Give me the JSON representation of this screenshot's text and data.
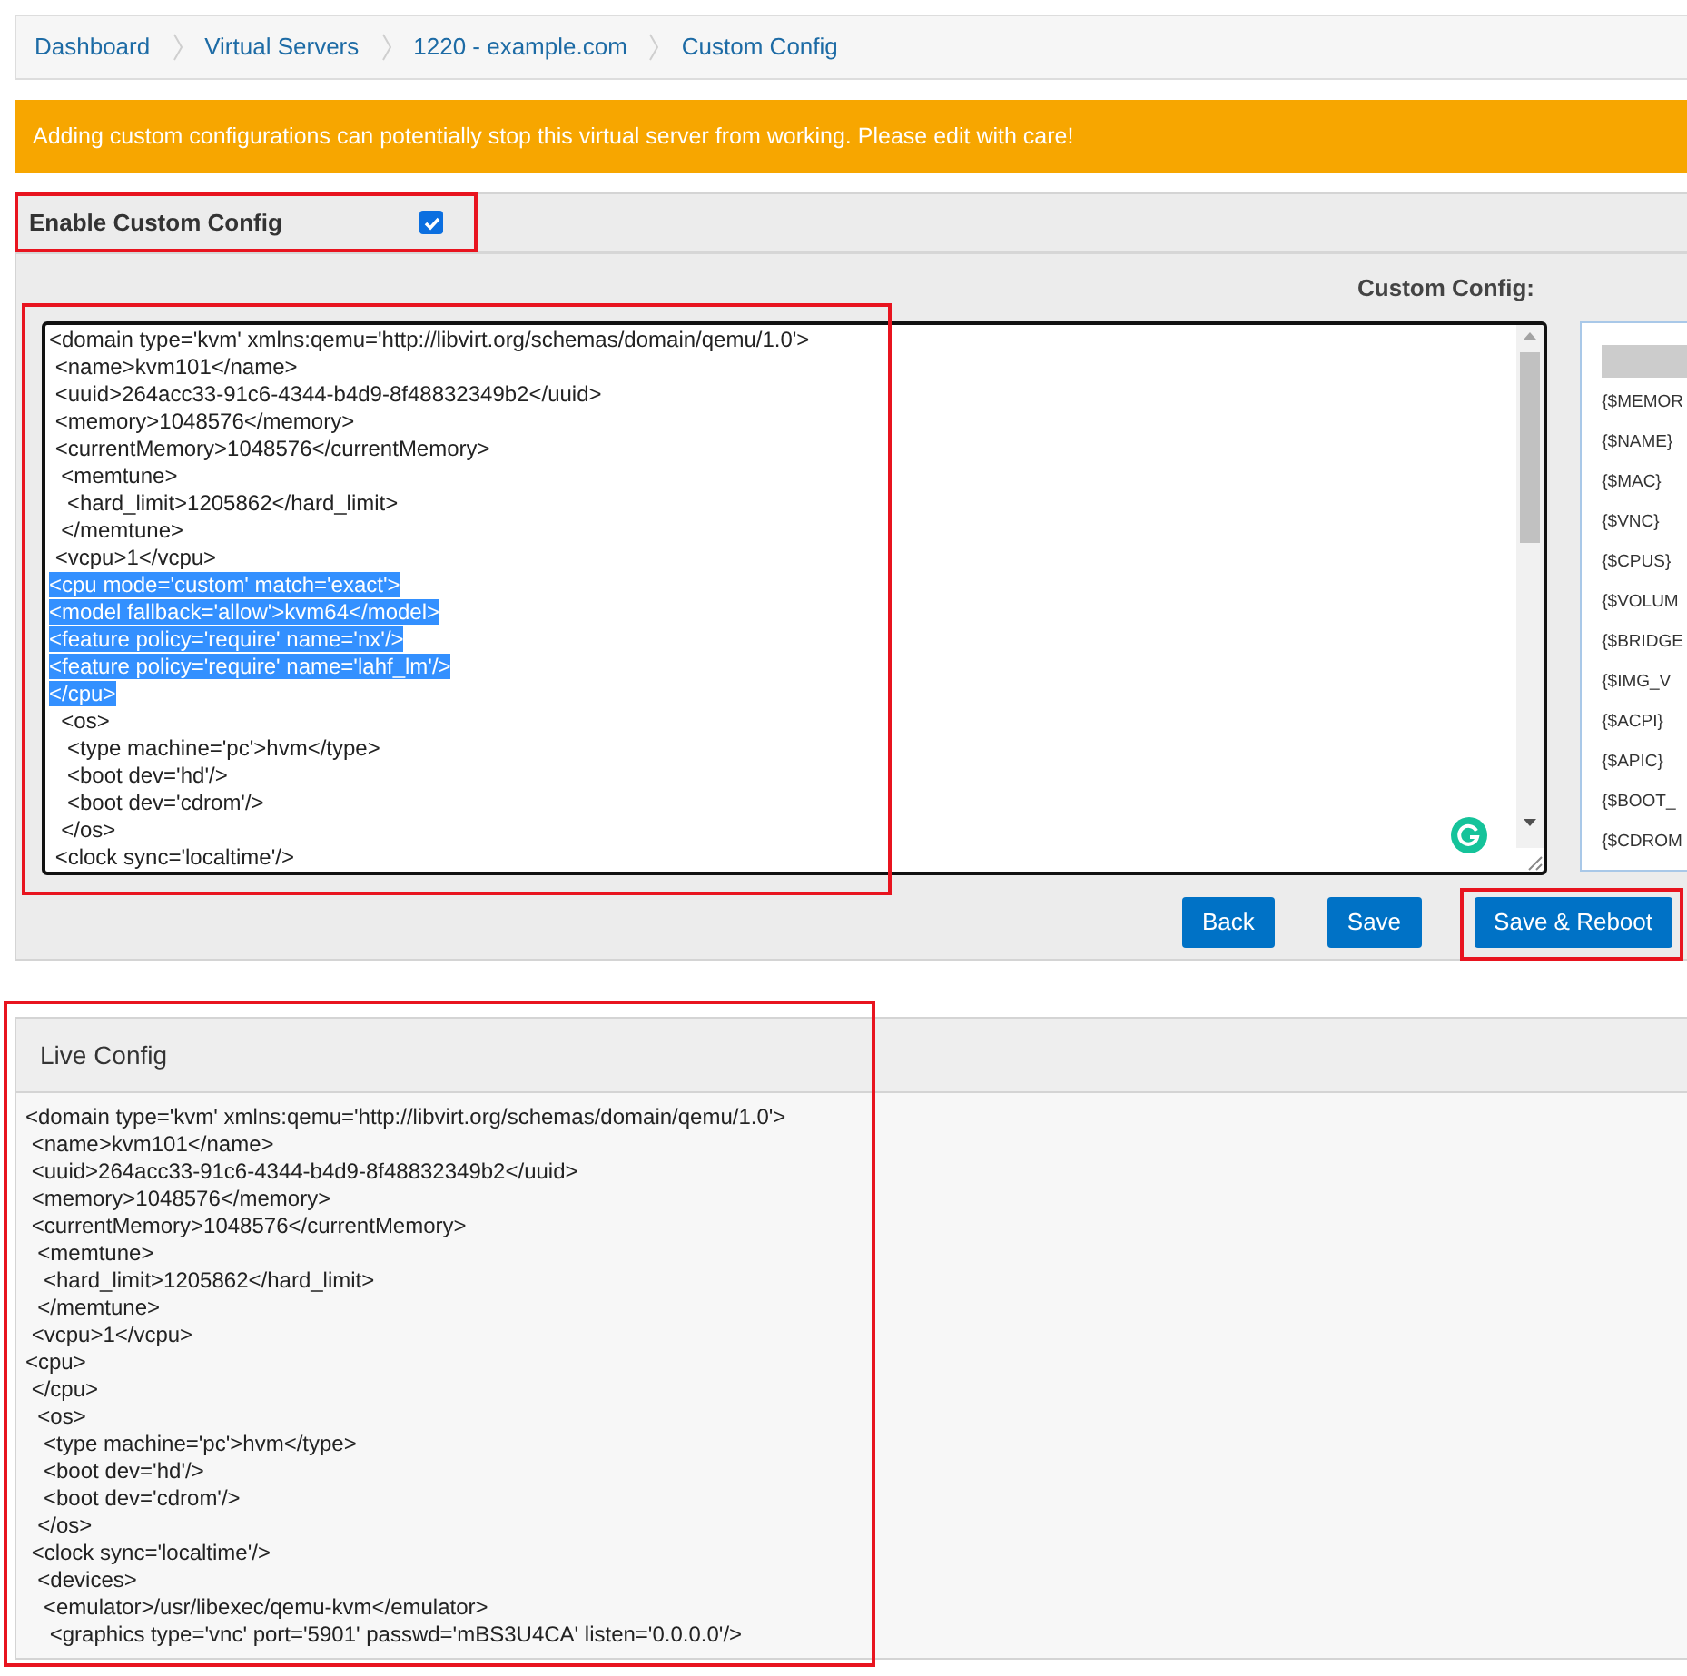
{
  "breadcrumb": [
    {
      "label": "Dashboard"
    },
    {
      "label": "Virtual Servers"
    },
    {
      "label": "1220 - example.com"
    },
    {
      "label": "Custom Config"
    }
  ],
  "warning": "Adding custom configurations can potentially stop this virtual server from working. Please edit with care!",
  "enable_custom_config": {
    "label": "Enable Custom Config",
    "checked": true
  },
  "custom_config": {
    "label": "Custom Config:",
    "editor_lines": [
      {
        "text": "<domain type='kvm' xmlns:qemu='http://libvirt.org/schemas/domain/qemu/1.0'>",
        "selected": false
      },
      {
        "text": " <name>kvm101</name>",
        "selected": false
      },
      {
        "text": " <uuid>264acc33-91c6-4344-b4d9-8f48832349b2</uuid>",
        "selected": false
      },
      {
        "text": " <memory>1048576</memory>",
        "selected": false
      },
      {
        "text": " <currentMemory>1048576</currentMemory>",
        "selected": false
      },
      {
        "text": "  <memtune>",
        "selected": false
      },
      {
        "text": "   <hard_limit>1205862</hard_limit>",
        "selected": false
      },
      {
        "text": "  </memtune>",
        "selected": false
      },
      {
        "text": " <vcpu>1</vcpu>",
        "selected": false
      },
      {
        "text": "<cpu mode='custom' match='exact'>",
        "selected": true
      },
      {
        "text": "<model fallback='allow'>kvm64</model>",
        "selected": true
      },
      {
        "text": "<feature policy='require' name='nx'/>",
        "selected": true
      },
      {
        "text": "<feature policy='require' name='lahf_lm'/>",
        "selected": true
      },
      {
        "text": "</cpu>",
        "selected": true
      },
      {
        "text": "  <os>",
        "selected": false
      },
      {
        "text": "   <type machine='pc'>hvm</type>",
        "selected": false
      },
      {
        "text": "   <boot dev='hd'/>",
        "selected": false
      },
      {
        "text": "   <boot dev='cdrom'/>",
        "selected": false
      },
      {
        "text": "  </os>",
        "selected": false
      },
      {
        "text": " <clock sync='localtime'/>",
        "selected": false
      }
    ],
    "variables": [
      "{$MEMOR",
      "{$NAME}",
      "{$MAC}",
      "{$VNC}",
      "{$CPUS}",
      "{$VOLUM",
      "{$BRIDGE",
      "{$IMG_V",
      "{$ACPI}",
      "{$APIC}",
      "{$BOOT_",
      "{$CDROM"
    ],
    "buttons": [
      "Back",
      "Save",
      "Save & Reboot"
    ]
  },
  "live_config": {
    "title": "Live Config",
    "lines": [
      "<domain type='kvm' xmlns:qemu='http://libvirt.org/schemas/domain/qemu/1.0'>",
      " <name>kvm101</name>",
      " <uuid>264acc33-91c6-4344-b4d9-8f48832349b2</uuid>",
      " <memory>1048576</memory>",
      " <currentMemory>1048576</currentMemory>",
      "  <memtune>",
      "   <hard_limit>1205862</hard_limit>",
      "  </memtune>",
      " <vcpu>1</vcpu>",
      "<cpu>",
      " </cpu>",
      "  <os>",
      "   <type machine='pc'>hvm</type>",
      "   <boot dev='hd'/>",
      "   <boot dev='cdrom'/>",
      "  </os>",
      " <clock sync='localtime'/>",
      "  <devices>",
      "   <emulator>/usr/libexec/qemu-kvm</emulator>",
      "    <graphics type='vnc' port='5901' passwd='mBS3U4CA' listen='0.0.0.0'/>"
    ]
  }
}
